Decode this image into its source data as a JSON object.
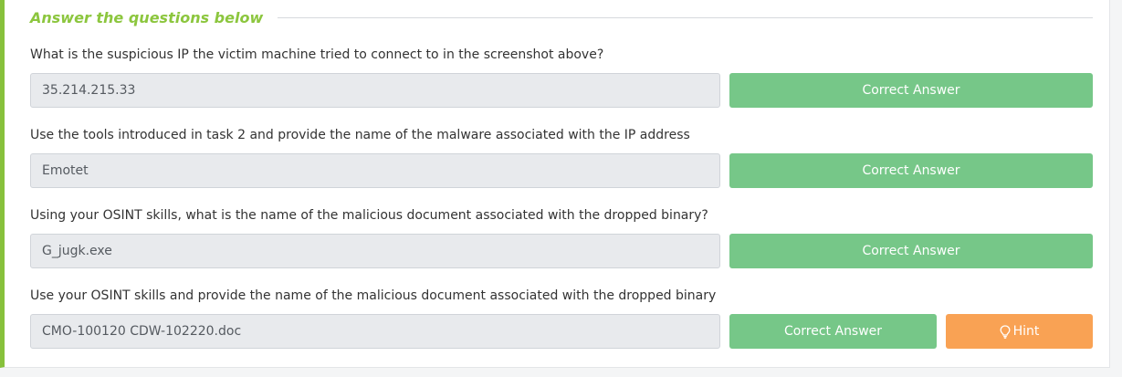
{
  "section": {
    "title": "Answer the questions below"
  },
  "questions": [
    {
      "text": "What is the suspicious IP the victim machine tried to connect to in the screenshot above?",
      "answer": "35.214.215.33",
      "button": "Correct Answer"
    },
    {
      "text": "Use the tools introduced in task 2 and provide the name of the malware associated with the IP address",
      "answer": "Emotet",
      "button": "Correct Answer"
    },
    {
      "text": "Using your OSINT skills, what is the name of the malicious document associated with the dropped binary?",
      "answer": "G_jugk.exe",
      "button": "Correct Answer"
    },
    {
      "text": "Use your OSINT skills and provide the name of the malicious document associated with the dropped binary",
      "answer": "CMO-100120 CDW-102220.doc",
      "button": "Correct Answer",
      "hint": "Hint"
    }
  ],
  "colors": {
    "accent_green": "#87c13c",
    "correct_button": "#76c788",
    "hint_button": "#f9a254"
  },
  "icons": {
    "hint": "lightbulb-icon"
  }
}
